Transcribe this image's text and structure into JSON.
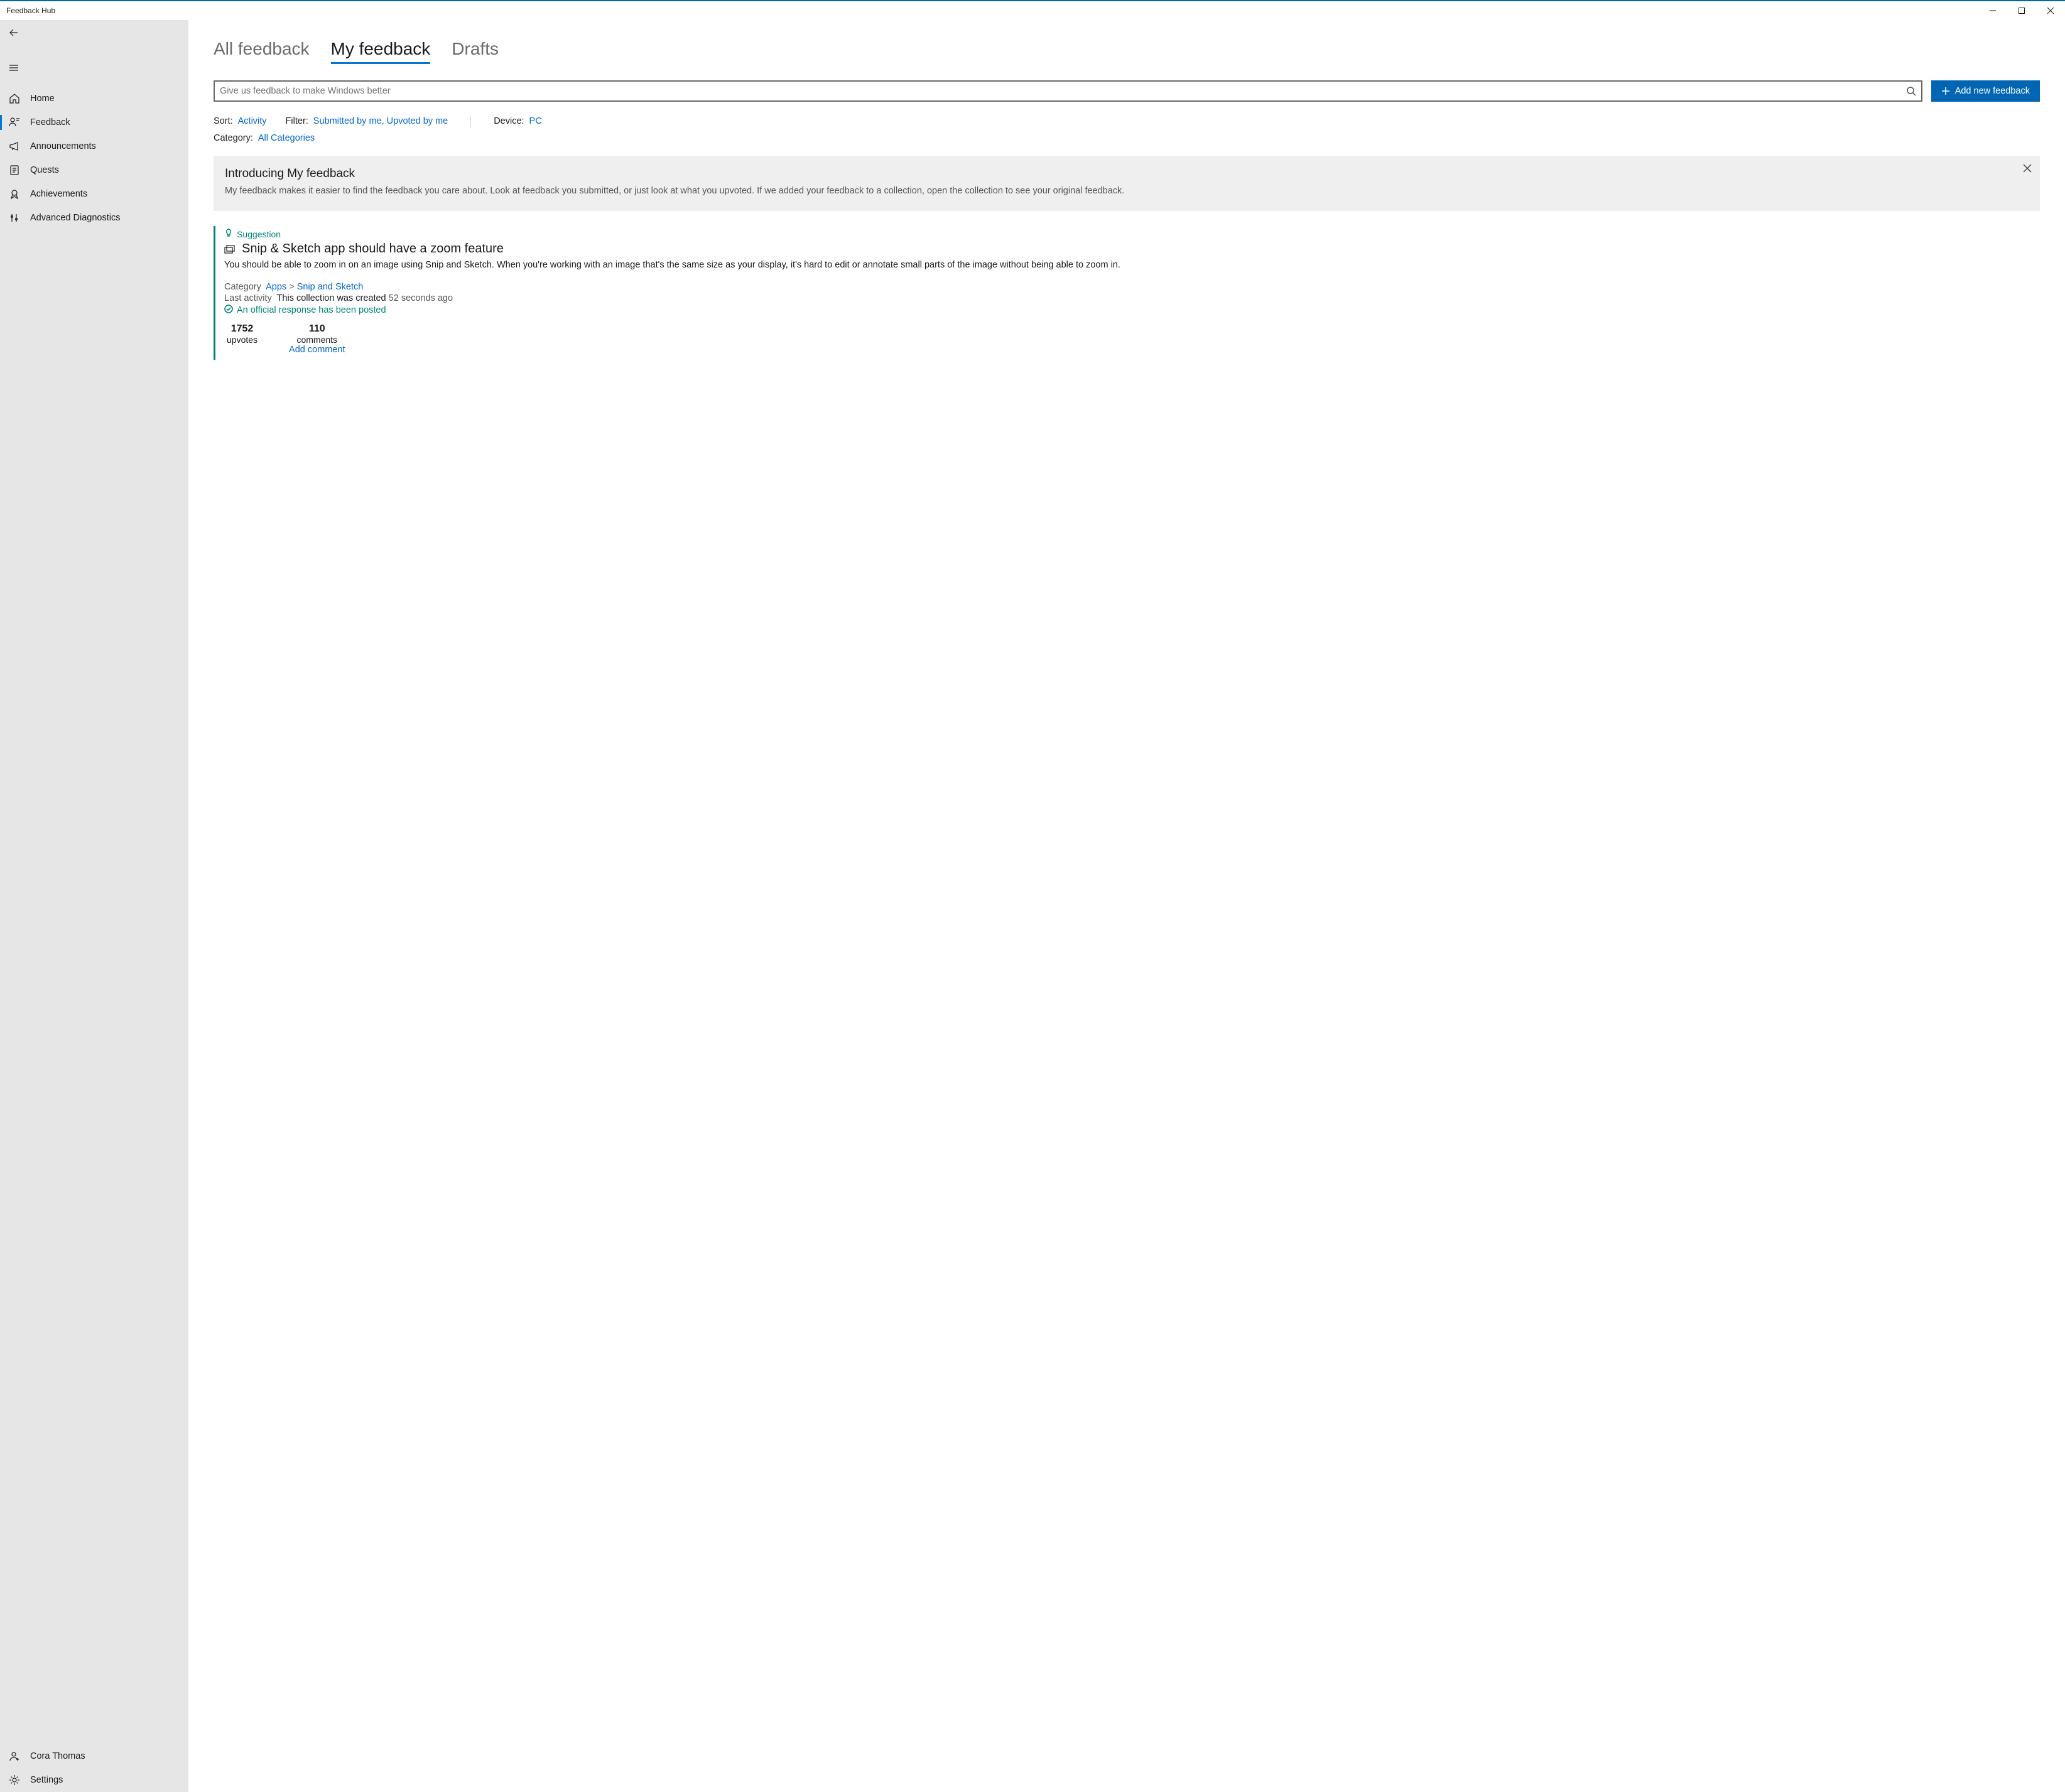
{
  "window": {
    "title": "Feedback Hub"
  },
  "sidebar": {
    "items": [
      {
        "label": "Home"
      },
      {
        "label": "Feedback"
      },
      {
        "label": "Announcements"
      },
      {
        "label": "Quests"
      },
      {
        "label": "Achievements"
      },
      {
        "label": "Advanced Diagnostics"
      }
    ],
    "user": "Cora Thomas",
    "settings": "Settings"
  },
  "tabs": {
    "all": "All feedback",
    "my": "My feedback",
    "drafts": "Drafts"
  },
  "search": {
    "placeholder": "Give us feedback to make Windows better"
  },
  "add_button": "Add new feedback",
  "filters": {
    "sort_label": "Sort:",
    "sort_value": "Activity",
    "filter_label": "Filter:",
    "filter_value": "Submitted by me, Upvoted by me",
    "device_label": "Device:",
    "device_value": "PC",
    "category_label": "Category:",
    "category_value": "All Categories"
  },
  "banner": {
    "title": "Introducing My feedback",
    "body": "My feedback makes it easier to find the feedback you care about. Look at feedback you submitted, or just look at what you upvoted. If we added your feedback to a collection, open the collection to see your original feedback."
  },
  "feedback_item": {
    "badge": "Suggestion",
    "title": "Snip & Sketch app should have a zoom feature",
    "body": "You should be able to zoom in on an image using Snip and Sketch. When you're working with an image that's the same size as your display, it's hard to edit or annotate small parts of the image without being able to zoom in.",
    "category_label": "Category",
    "category_value": "Apps",
    "category_sep": ">",
    "subcategory_value": "Snip and Sketch",
    "activity_label": "Last activity",
    "activity_text": "This collection was created",
    "activity_time": "52 seconds ago",
    "official_response": "An official response has been posted",
    "upvotes_count": "1752",
    "upvotes_label": "upvotes",
    "comments_count": "110",
    "comments_label": "comments",
    "add_comment": "Add comment"
  }
}
